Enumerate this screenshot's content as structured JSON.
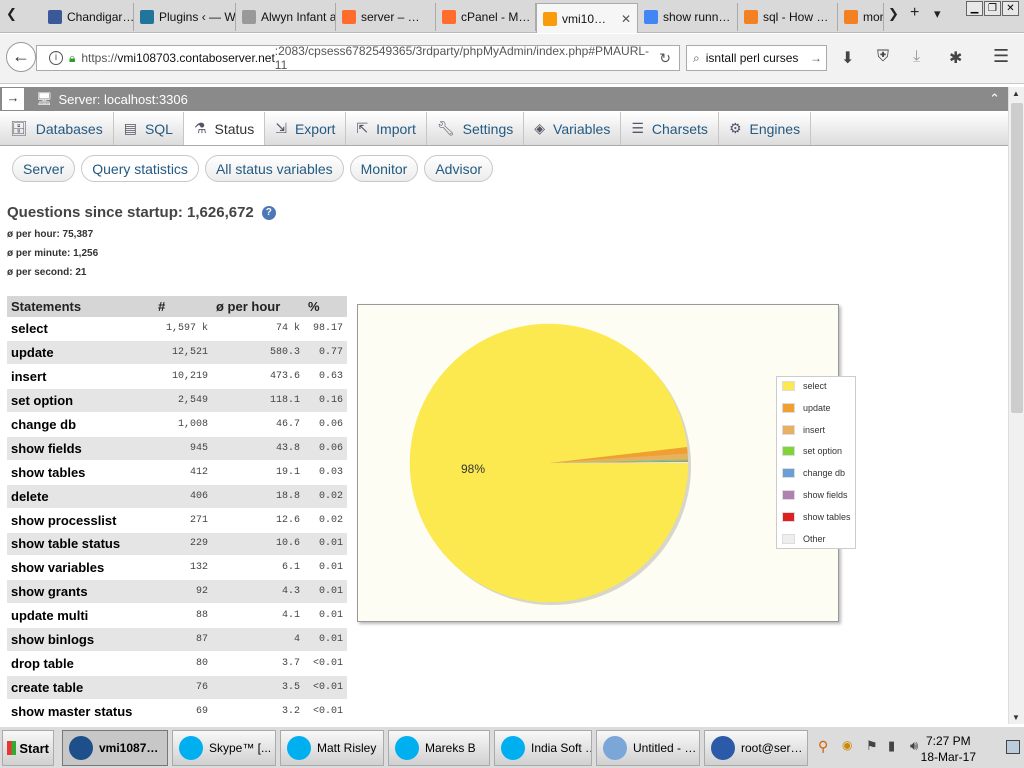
{
  "browser": {
    "tabs": [
      {
        "label": "Chandigar…",
        "icon": "facebook-icon",
        "color": "#3b5998"
      },
      {
        "label": "Plugins ‹ — Wo…",
        "icon": "wordpress-icon",
        "color": "#21759b"
      },
      {
        "label": "Alwyn Infant a…",
        "icon": "page-icon",
        "color": "#999999"
      },
      {
        "label": "server – …",
        "icon": "cpanel-icon",
        "color": "#ff6c2c"
      },
      {
        "label": "cPanel - M…",
        "icon": "cpanel-icon",
        "color": "#ff6c2c"
      },
      {
        "label": "vmi10…",
        "icon": "phpmyadmin-icon",
        "color": "#f89c0e"
      },
      {
        "label": "show runn…",
        "icon": "google-icon",
        "color": "#4285f4"
      },
      {
        "label": "sql - How …",
        "icon": "stackoverflow-icon",
        "color": "#f48024"
      },
      {
        "label": "mor",
        "icon": "stackoverflow-icon",
        "color": "#f48024"
      }
    ],
    "url_prefix": "https://",
    "url_host": "vmi108703.contaboserver.net",
    "url_path": ":2083/cpsess6782549365/3rdparty/phpMyAdmin/index.php#PMAURL-11",
    "search_text": "isntall perl curses"
  },
  "server": {
    "label": "Server: localhost:3306"
  },
  "menu": {
    "tabs": [
      "Databases",
      "SQL",
      "Status",
      "Export",
      "Import",
      "Settings",
      "Variables",
      "Charsets",
      "Engines"
    ],
    "active": "Status"
  },
  "subtabs": {
    "items": [
      "Server",
      "Query statistics",
      "All status variables",
      "Monitor",
      "Advisor"
    ],
    "active": "Query statistics"
  },
  "questions": {
    "title": "Questions since startup: 1,626,672",
    "per_hour": "ø per hour: 75,387",
    "per_minute": "ø per minute: 1,256",
    "per_second": "ø per second: 21"
  },
  "table": {
    "headers": [
      "Statements",
      "#",
      "ø per hour",
      "%"
    ],
    "rows": [
      [
        "select",
        "1,597 k",
        "74 k",
        "98.17"
      ],
      [
        "update",
        "12,521",
        "580.3",
        "0.77"
      ],
      [
        "insert",
        "10,219",
        "473.6",
        "0.63"
      ],
      [
        "set option",
        "2,549",
        "118.1",
        "0.16"
      ],
      [
        "change db",
        "1,008",
        "46.7",
        "0.06"
      ],
      [
        "show fields",
        "945",
        "43.8",
        "0.06"
      ],
      [
        "show tables",
        "412",
        "19.1",
        "0.03"
      ],
      [
        "delete",
        "406",
        "18.8",
        "0.02"
      ],
      [
        "show processlist",
        "271",
        "12.6",
        "0.02"
      ],
      [
        "show table status",
        "229",
        "10.6",
        "0.01"
      ],
      [
        "show variables",
        "132",
        "6.1",
        "0.01"
      ],
      [
        "show grants",
        "92",
        "4.3",
        "0.01"
      ],
      [
        "update multi",
        "88",
        "4.1",
        "0.01"
      ],
      [
        "show binlogs",
        "87",
        "4",
        "0.01"
      ],
      [
        "drop table",
        "80",
        "3.7",
        "<0.01"
      ],
      [
        "create table",
        "76",
        "3.5",
        "<0.01"
      ],
      [
        "show master status",
        "69",
        "3.2",
        "<0.01"
      ]
    ]
  },
  "chart_data": {
    "type": "pie",
    "slices": [
      {
        "label": "select",
        "value": 98.17,
        "color": "#fce94f"
      },
      {
        "label": "update",
        "value": 0.77,
        "color": "#f0a030"
      },
      {
        "label": "insert",
        "value": 0.63,
        "color": "#e8b060"
      },
      {
        "label": "set option",
        "value": 0.16,
        "color": "#7fd43a"
      },
      {
        "label": "change db",
        "value": 0.06,
        "color": "#6a9fd8"
      },
      {
        "label": "show fields",
        "value": 0.06,
        "color": "#b080b0"
      },
      {
        "label": "show tables",
        "value": 0.03,
        "color": "#e02020"
      },
      {
        "label": "Other",
        "value": 0.12,
        "color": "#eeeeee"
      }
    ],
    "data_label": "98%",
    "legend_position": "right"
  },
  "taskbar": {
    "start": "Start",
    "items": [
      {
        "label": "vmi1087…",
        "color": "#1d4f8a"
      },
      {
        "label": "Skype™ [...",
        "color": "#00aff0"
      },
      {
        "label": "Matt Risley",
        "color": "#00aff0"
      },
      {
        "label": "Mareks B",
        "color": "#00aff0"
      },
      {
        "label": "India Soft …",
        "color": "#00aff0"
      },
      {
        "label": "Untitled - …",
        "color": "#7aa6d8"
      },
      {
        "label": "root@ser…",
        "color": "#2a5aa8"
      }
    ],
    "time": "7:27 PM",
    "date": "18-Mar-17"
  }
}
